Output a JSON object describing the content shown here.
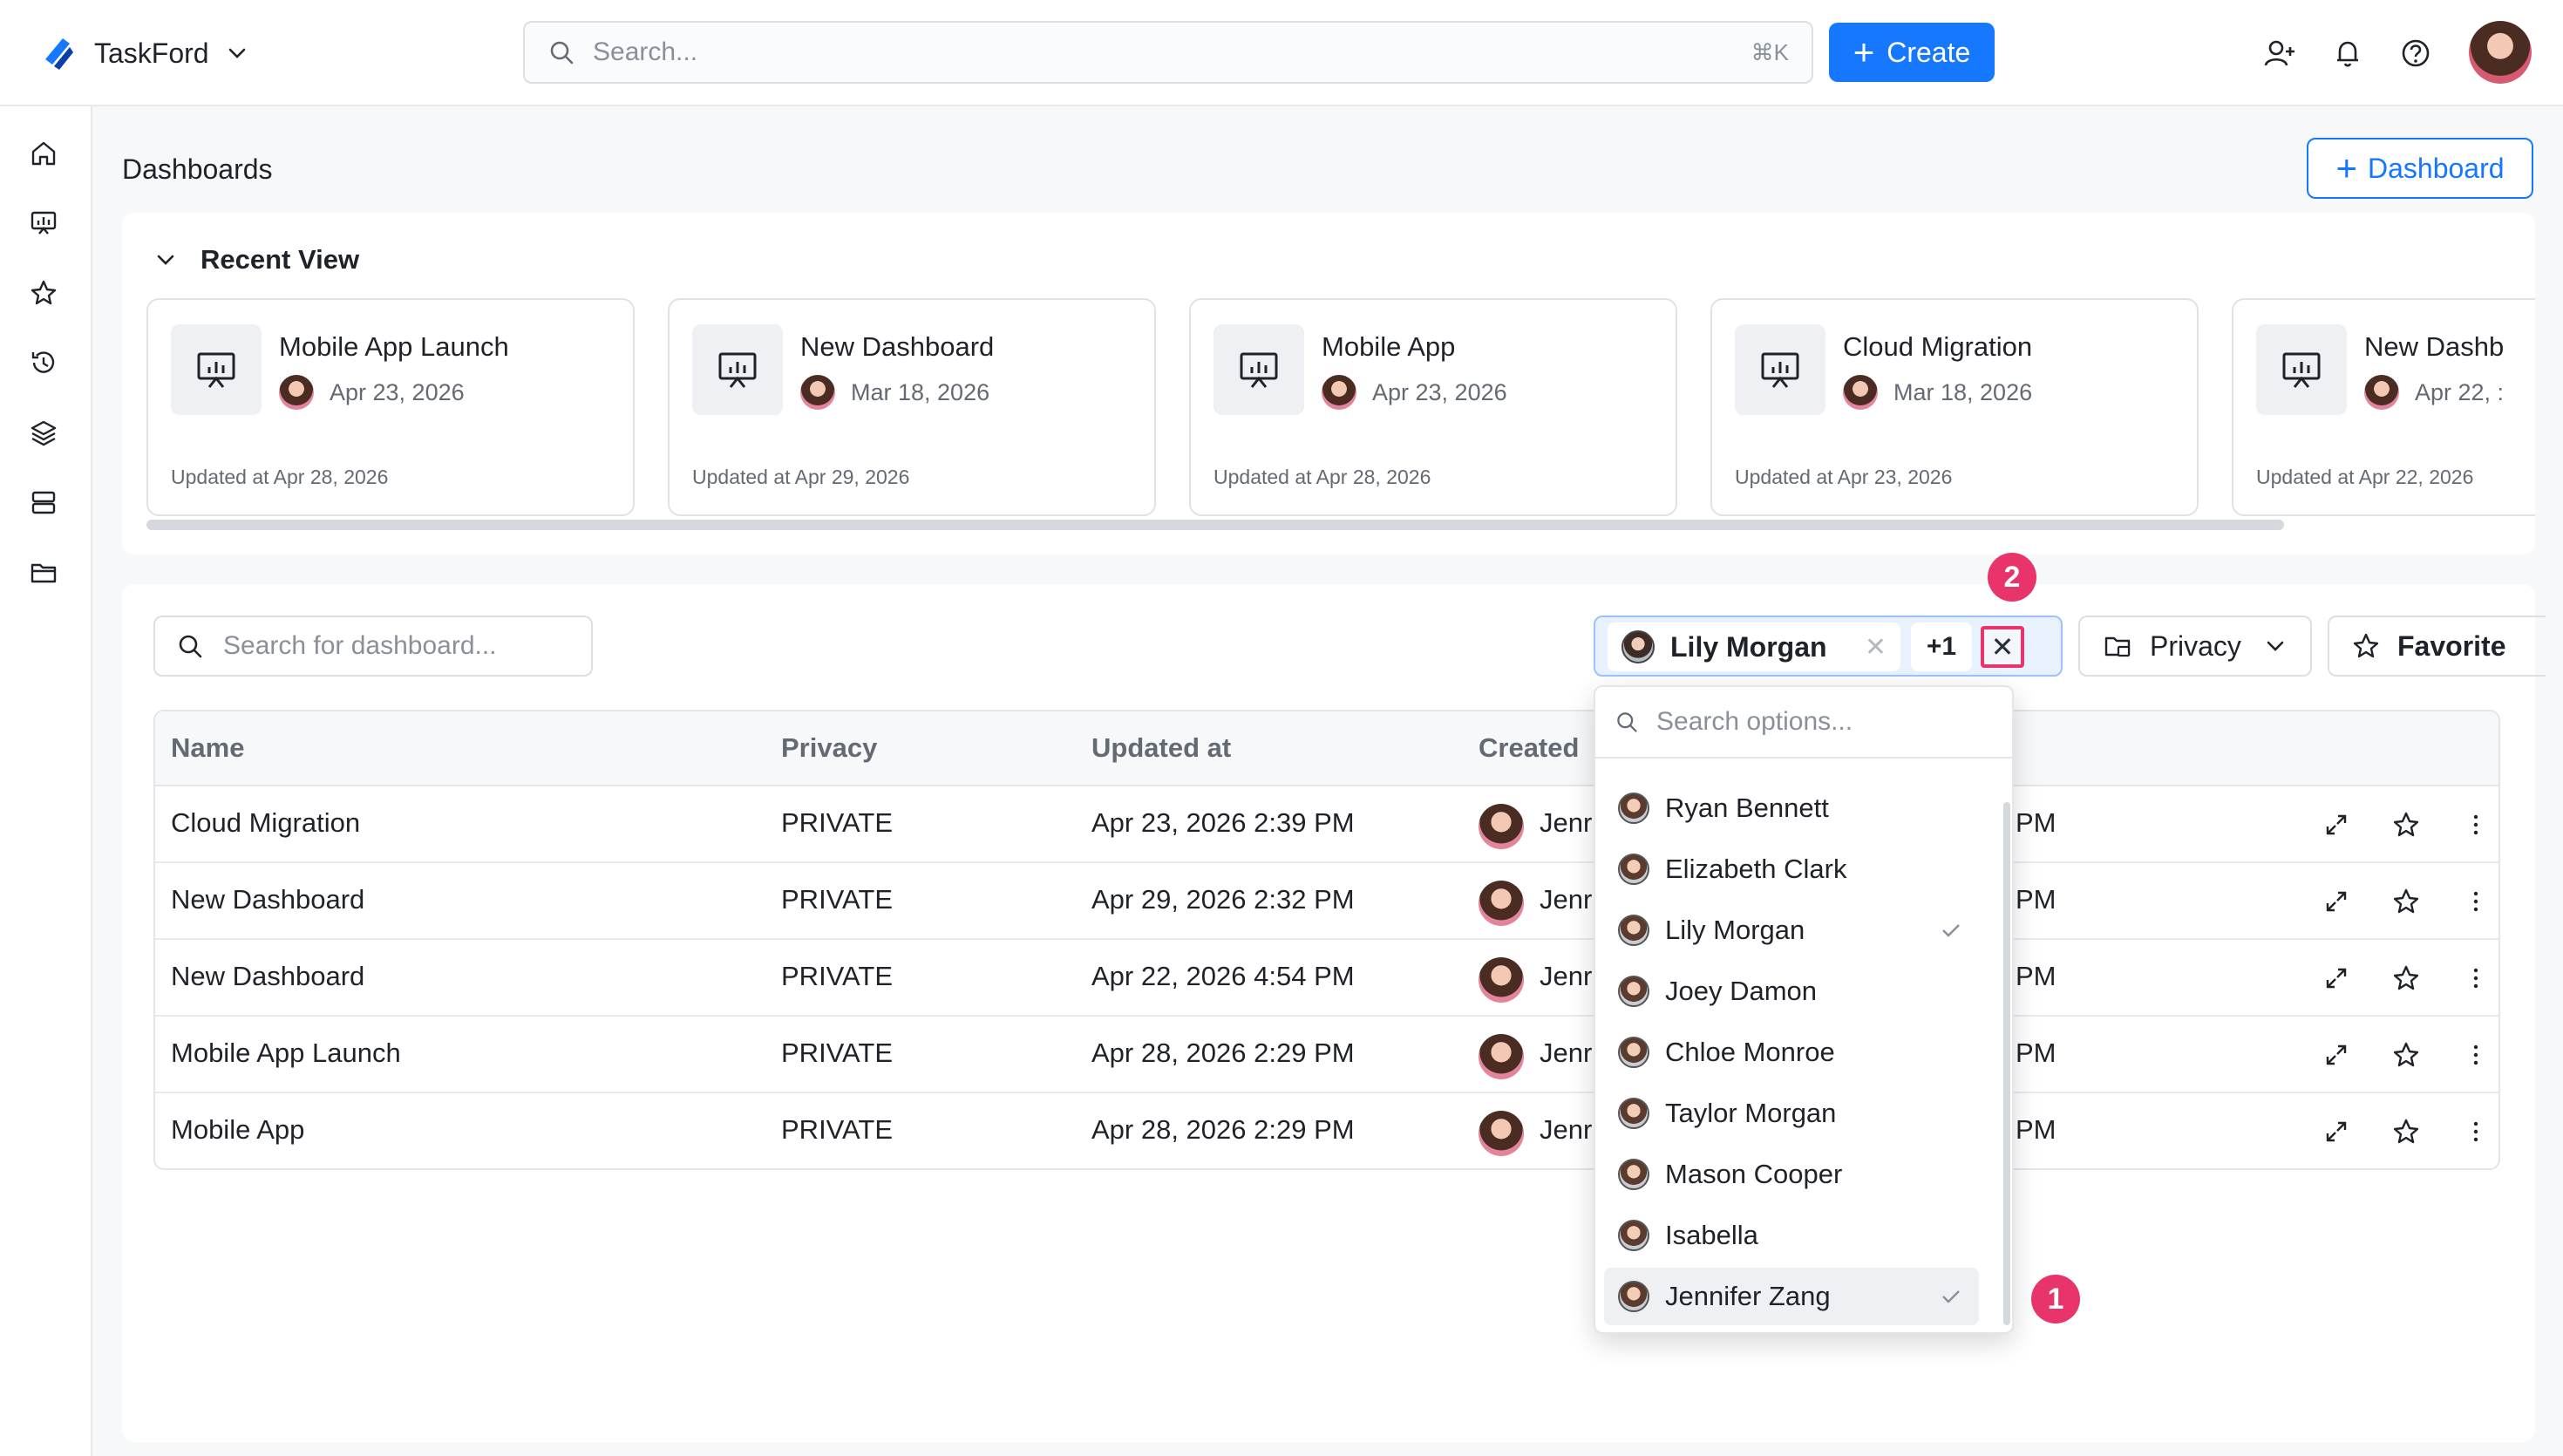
{
  "app": {
    "name": "TaskFord",
    "search_placeholder": "Search...",
    "search_shortcut": "⌘K",
    "create_label": "Create"
  },
  "page": {
    "title": "Dashboards",
    "add_dashboard_label": "Dashboard"
  },
  "recent": {
    "header": "Recent View",
    "cards": [
      {
        "title": "Mobile App Launch",
        "date": "Apr 23, 2026",
        "updated": "Updated at Apr 28, 2026"
      },
      {
        "title": "New Dashboard",
        "date": "Mar 18, 2026",
        "updated": "Updated at Apr 29, 2026"
      },
      {
        "title": "Mobile App",
        "date": "Apr 23, 2026",
        "updated": "Updated at Apr 28, 2026"
      },
      {
        "title": "Cloud Migration",
        "date": "Mar 18, 2026",
        "updated": "Updated at Apr 23, 2026"
      },
      {
        "title": "New Dashb",
        "date": "Apr 22, :",
        "updated": "Updated at Apr 22, 2026"
      }
    ]
  },
  "list": {
    "search_placeholder": "Search for dashboard...",
    "filter": {
      "selected_name": "Lily Morgan",
      "more_count": "+1"
    },
    "privacy_label": "Privacy",
    "favorite_label": "Favorite",
    "columns": [
      "Name",
      "Privacy",
      "Updated at",
      "Created"
    ],
    "rows": [
      {
        "name": "Cloud Migration",
        "privacy": "PRIVATE",
        "updated": "Apr 23, 2026 2:39 PM",
        "creator": "Jenr",
        "tail": "PM"
      },
      {
        "name": "New Dashboard",
        "privacy": "PRIVATE",
        "updated": "Apr 29, 2026 2:32 PM",
        "creator": "Jenr",
        "tail": "PM"
      },
      {
        "name": "New Dashboard",
        "privacy": "PRIVATE",
        "updated": "Apr 22, 2026 4:54 PM",
        "creator": "Jenr",
        "tail": "PM"
      },
      {
        "name": "Mobile App Launch",
        "privacy": "PRIVATE",
        "updated": "Apr 28, 2026 2:29 PM",
        "creator": "Jenr",
        "tail": "PM"
      },
      {
        "name": "Mobile App",
        "privacy": "PRIVATE",
        "updated": "Apr 28, 2026 2:29 PM",
        "creator": "Jenr",
        "tail": "PM"
      }
    ]
  },
  "dropdown": {
    "search_placeholder": "Search options...",
    "options": [
      {
        "name": "Ryan Bennett",
        "checked": false
      },
      {
        "name": "Elizabeth Clark",
        "checked": false
      },
      {
        "name": "Lily Morgan",
        "checked": true
      },
      {
        "name": "Joey Damon",
        "checked": false
      },
      {
        "name": "Chloe Monroe",
        "checked": false
      },
      {
        "name": "Taylor Morgan",
        "checked": false
      },
      {
        "name": "Mason Cooper",
        "checked": false
      },
      {
        "name": "Isabella",
        "checked": false
      },
      {
        "name": "Jennifer Zang",
        "checked": true
      }
    ]
  },
  "callouts": [
    "1",
    "2"
  ],
  "colors": {
    "accent": "#1677ff",
    "callout": "#e8336b"
  }
}
